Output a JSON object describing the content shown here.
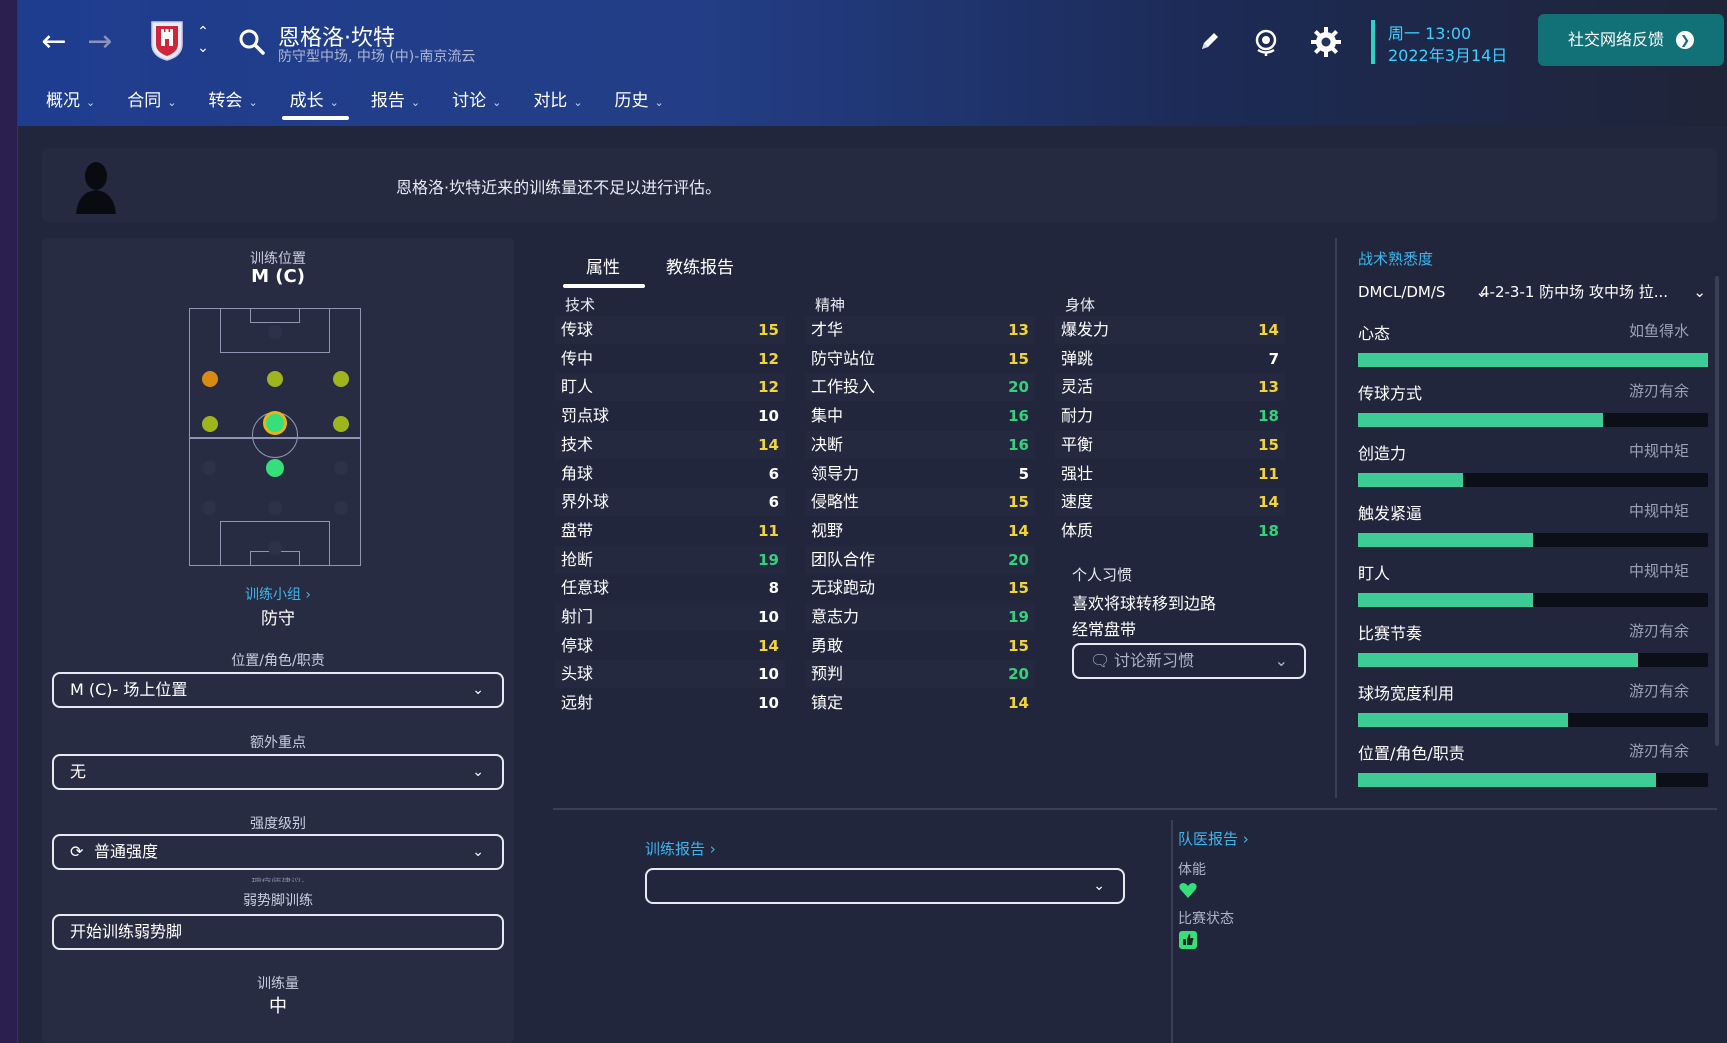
{
  "header": {
    "player_name": "恩格洛·坎特",
    "player_subtitle": "防守型中场, 中场 (中)-南京流云",
    "date_line1": "周一 13:00",
    "date_line2": "2022年3月14日",
    "social_button": "社交网络反馈",
    "menu": [
      {
        "label": "概况"
      },
      {
        "label": "合同"
      },
      {
        "label": "转会"
      },
      {
        "label": "成长"
      },
      {
        "label": "报告"
      },
      {
        "label": "讨论"
      },
      {
        "label": "对比"
      },
      {
        "label": "历史"
      }
    ],
    "active_menu": "成长"
  },
  "info": {
    "message": "恩格洛·坎特近来的训练量还不足以进行评估。"
  },
  "left": {
    "training_position_label": "训练位置",
    "training_position_value": "M (C)",
    "training_group_link": "训练小组",
    "training_group_value": "防守",
    "position_role_label": "位置/角色/职责",
    "position_role_value": "M (C)- 场上位置",
    "extra_focus_label": "额外重点",
    "extra_focus_value": "无",
    "intensity_label": "强度级别",
    "intensity_value": "普通强度",
    "physio_hint": "理疗师建议:",
    "weak_foot_label": "弱势脚训练",
    "weak_foot_value": "开始训练弱势脚",
    "workload_label": "训练量",
    "workload_value": "中"
  },
  "attributes": {
    "tabs": [
      "属性",
      "教练报告"
    ],
    "columns": [
      {
        "title": "技术",
        "items": [
          {
            "name": "传球",
            "value": "15"
          },
          {
            "name": "传中",
            "value": "12"
          },
          {
            "name": "盯人",
            "value": "12"
          },
          {
            "name": "罚点球",
            "value": "10"
          },
          {
            "name": "技术",
            "value": "14"
          },
          {
            "name": "角球",
            "value": "6"
          },
          {
            "name": "界外球",
            "value": "6"
          },
          {
            "name": "盘带",
            "value": "11"
          },
          {
            "name": "抢断",
            "value": "19"
          },
          {
            "name": "任意球",
            "value": "8"
          },
          {
            "name": "射门",
            "value": "10"
          },
          {
            "name": "停球",
            "value": "14"
          },
          {
            "name": "头球",
            "value": "10"
          },
          {
            "name": "远射",
            "value": "10"
          }
        ]
      },
      {
        "title": "精神",
        "items": [
          {
            "name": "才华",
            "value": "13"
          },
          {
            "name": "防守站位",
            "value": "15"
          },
          {
            "name": "工作投入",
            "value": "20"
          },
          {
            "name": "集中",
            "value": "16"
          },
          {
            "name": "决断",
            "value": "16"
          },
          {
            "name": "领导力",
            "value": "5"
          },
          {
            "name": "侵略性",
            "value": "15"
          },
          {
            "name": "视野",
            "value": "14"
          },
          {
            "name": "团队合作",
            "value": "20"
          },
          {
            "name": "无球跑动",
            "value": "15"
          },
          {
            "name": "意志力",
            "value": "19"
          },
          {
            "name": "勇敢",
            "value": "15"
          },
          {
            "name": "预判",
            "value": "20"
          },
          {
            "name": "镇定",
            "value": "14"
          }
        ]
      },
      {
        "title": "身体",
        "items": [
          {
            "name": "爆发力",
            "value": "14"
          },
          {
            "name": "弹跳",
            "value": "7"
          },
          {
            "name": "灵活",
            "value": "13"
          },
          {
            "name": "耐力",
            "value": "18"
          },
          {
            "name": "平衡",
            "value": "15"
          },
          {
            "name": "强壮",
            "value": "11"
          },
          {
            "name": "速度",
            "value": "14"
          },
          {
            "name": "体质",
            "value": "18"
          }
        ]
      }
    ],
    "habits_title": "个人习惯",
    "habits": [
      "喜欢将球转移到边路",
      "经常盘带"
    ],
    "discuss_habit": "讨论新习惯"
  },
  "tactics": {
    "title": "战术熟悉度",
    "select_position": "DMCL/DM/S",
    "select_tactic": "4-2-3-1 防中场 攻中场 拉...",
    "items": [
      {
        "name": "心态",
        "level": "如鱼得水",
        "fill": 1.0
      },
      {
        "name": "传球方式",
        "level": "游刃有余",
        "fill": 0.7
      },
      {
        "name": "创造力",
        "level": "中规中矩",
        "fill": 0.3
      },
      {
        "name": "触发紧逼",
        "level": "中规中矩",
        "fill": 0.5
      },
      {
        "name": "盯人",
        "level": "中规中矩",
        "fill": 0.5
      },
      {
        "name": "比赛节奏",
        "level": "游刃有余",
        "fill": 0.8
      },
      {
        "name": "球场宽度利用",
        "level": "游刃有余",
        "fill": 0.6
      },
      {
        "name": "位置/角色/职责",
        "level": "游刃有余",
        "fill": 0.85
      }
    ]
  },
  "bottom": {
    "training_report_link": "训练报告",
    "medical_report_link": "队医报告",
    "fitness_label": "体能",
    "match_condition_label": "比赛状态"
  },
  "colors": {
    "value_yellow": "#f0d43a",
    "value_green": "#35d17a",
    "value_white": "#ffffff",
    "accent_cyan": "#3ab6f0",
    "bar_green": "#3dcc95"
  }
}
